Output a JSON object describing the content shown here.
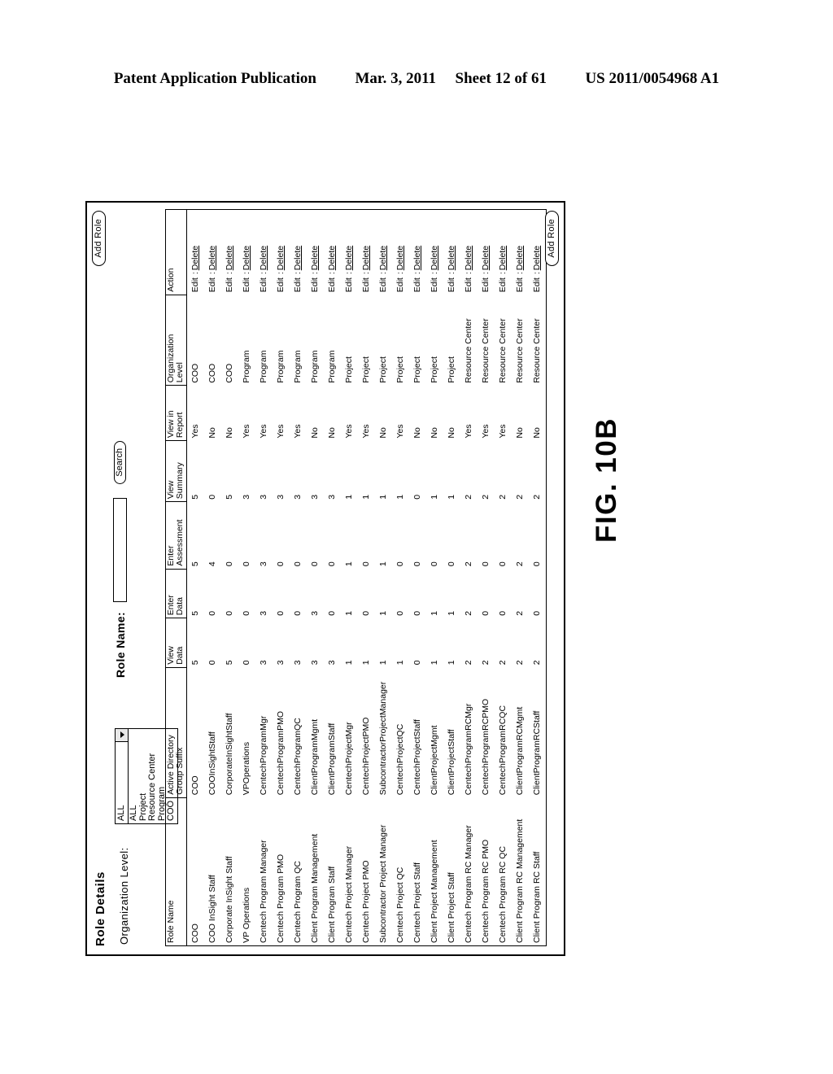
{
  "page_header": {
    "publication": "Patent Application Publication",
    "date": "Mar. 3, 2011",
    "sheet": "Sheet 12 of 61",
    "number": "US 2011/0054968 A1"
  },
  "figure_caption": "FIG. 10B",
  "window": {
    "title": "Role Details",
    "add_role_top": "Add Role",
    "add_role_bottom": "Add Role"
  },
  "filters": {
    "org_level_label": "Organization Level:",
    "org_level_value": "ALL",
    "org_level_options": [
      "ALL",
      "Project",
      "Resource Center",
      "Program",
      "COO"
    ],
    "role_name_label": "Role Name:",
    "role_name_value": "",
    "role_name_placeholder": "",
    "search_button": "Search"
  },
  "table": {
    "columns": [
      "Role Name",
      "Active Directory Group Suffix",
      "View Data",
      "Enter Data",
      "Enter Assessment",
      "View Summary",
      "View in Report",
      "Organization Level",
      "Action"
    ],
    "columns_split": [
      {
        "l1": "Role Name",
        "l2": ""
      },
      {
        "l1": "Active Directory",
        "l2": "Group Suffix"
      },
      {
        "l1": "View",
        "l2": "Data"
      },
      {
        "l1": "Enter",
        "l2": "Data"
      },
      {
        "l1": "Enter",
        "l2": "Assessment"
      },
      {
        "l1": "View",
        "l2": "Summary"
      },
      {
        "l1": "View in",
        "l2": "Report"
      },
      {
        "l1": "Organization",
        "l2": "Level"
      },
      {
        "l1": "Action",
        "l2": ""
      }
    ],
    "action_edit": "Edit",
    "action_sep": ":",
    "action_delete": "Delete",
    "rows": [
      {
        "role_name": "COO",
        "ad_suffix": "COO",
        "view_data": "5",
        "enter_data": "5",
        "enter_assessment": "5",
        "view_summary": "5",
        "view_in_report": "Yes",
        "org_level": "COO"
      },
      {
        "role_name": "COO InSight Staff",
        "ad_suffix": "COOInSightStaff",
        "view_data": "0",
        "enter_data": "0",
        "enter_assessment": "4",
        "view_summary": "0",
        "view_in_report": "No",
        "org_level": "COO"
      },
      {
        "role_name": "Corporate InSight Staff",
        "ad_suffix": "CorporateInSightStaff",
        "view_data": "5",
        "enter_data": "0",
        "enter_assessment": "0",
        "view_summary": "5",
        "view_in_report": "No",
        "org_level": "COO"
      },
      {
        "role_name": "VP Operations",
        "ad_suffix": "VPOperations",
        "view_data": "0",
        "enter_data": "0",
        "enter_assessment": "0",
        "view_summary": "3",
        "view_in_report": "Yes",
        "org_level": "Program"
      },
      {
        "role_name": "Centech Program Manager",
        "ad_suffix": "CentechProgramMgr",
        "view_data": "3",
        "enter_data": "3",
        "enter_assessment": "3",
        "view_summary": "3",
        "view_in_report": "Yes",
        "org_level": "Program"
      },
      {
        "role_name": "Centech Program PMO",
        "ad_suffix": "CentechProgramPMO",
        "view_data": "3",
        "enter_data": "0",
        "enter_assessment": "0",
        "view_summary": "3",
        "view_in_report": "Yes",
        "org_level": "Program"
      },
      {
        "role_name": "Centech Program QC",
        "ad_suffix": "CentechProgramQC",
        "view_data": "3",
        "enter_data": "0",
        "enter_assessment": "0",
        "view_summary": "3",
        "view_in_report": "Yes",
        "org_level": "Program"
      },
      {
        "role_name": "Client Program Management",
        "ad_suffix": "ClientProgramMgmt",
        "view_data": "3",
        "enter_data": "3",
        "enter_assessment": "0",
        "view_summary": "3",
        "view_in_report": "No",
        "org_level": "Program"
      },
      {
        "role_name": "Client Program Staff",
        "ad_suffix": "ClientProgramStaff",
        "view_data": "3",
        "enter_data": "0",
        "enter_assessment": "0",
        "view_summary": "3",
        "view_in_report": "No",
        "org_level": "Program"
      },
      {
        "role_name": "Centech Project Manager",
        "ad_suffix": "CentechProjectMgr",
        "view_data": "1",
        "enter_data": "1",
        "enter_assessment": "1",
        "view_summary": "1",
        "view_in_report": "Yes",
        "org_level": "Project"
      },
      {
        "role_name": "Centech Project PMO",
        "ad_suffix": "CentechProjectPMO",
        "view_data": "1",
        "enter_data": "0",
        "enter_assessment": "0",
        "view_summary": "1",
        "view_in_report": "Yes",
        "org_level": "Project"
      },
      {
        "role_name": "Subcontractor Project Manager",
        "ad_suffix": "SubcontractorProjectManager",
        "view_data": "1",
        "enter_data": "1",
        "enter_assessment": "1",
        "view_summary": "1",
        "view_in_report": "No",
        "org_level": "Project"
      },
      {
        "role_name": "Centech Project QC",
        "ad_suffix": "CentechProjectQC",
        "view_data": "1",
        "enter_data": "0",
        "enter_assessment": "0",
        "view_summary": "1",
        "view_in_report": "Yes",
        "org_level": "Project"
      },
      {
        "role_name": "Centech Project Staff",
        "ad_suffix": "CentechProjectStaff",
        "view_data": "0",
        "enter_data": "0",
        "enter_assessment": "0",
        "view_summary": "0",
        "view_in_report": "No",
        "org_level": "Project"
      },
      {
        "role_name": "Client Project Management",
        "ad_suffix": "ClientProjectMgmt",
        "view_data": "1",
        "enter_data": "1",
        "enter_assessment": "0",
        "view_summary": "1",
        "view_in_report": "No",
        "org_level": "Project"
      },
      {
        "role_name": "Client Project Staff",
        "ad_suffix": "ClientProjectStaff",
        "view_data": "1",
        "enter_data": "1",
        "enter_assessment": "0",
        "view_summary": "1",
        "view_in_report": "No",
        "org_level": "Project"
      },
      {
        "role_name": "Centech Program RC Manager",
        "ad_suffix": "CentechProgramRCMgr",
        "view_data": "2",
        "enter_data": "2",
        "enter_assessment": "2",
        "view_summary": "2",
        "view_in_report": "Yes",
        "org_level": "Resource Center"
      },
      {
        "role_name": "Centech Program RC PMO",
        "ad_suffix": "CentechProgramRCPMO",
        "view_data": "2",
        "enter_data": "0",
        "enter_assessment": "0",
        "view_summary": "2",
        "view_in_report": "Yes",
        "org_level": "Resource Center"
      },
      {
        "role_name": "Centech Program RC QC",
        "ad_suffix": "CentechProgramRCQC",
        "view_data": "2",
        "enter_data": "0",
        "enter_assessment": "0",
        "view_summary": "2",
        "view_in_report": "Yes",
        "org_level": "Resource Center"
      },
      {
        "role_name": "Client Program RC Management",
        "ad_suffix": "ClientProgramRCMgmt",
        "view_data": "2",
        "enter_data": "2",
        "enter_assessment": "2",
        "view_summary": "2",
        "view_in_report": "No",
        "org_level": "Resource Center"
      },
      {
        "role_name": "Client Program RC Staff",
        "ad_suffix": "ClientProgramRCStaff",
        "view_data": "2",
        "enter_data": "0",
        "enter_assessment": "0",
        "view_summary": "2",
        "view_in_report": "No",
        "org_level": "Resource Center"
      }
    ]
  }
}
